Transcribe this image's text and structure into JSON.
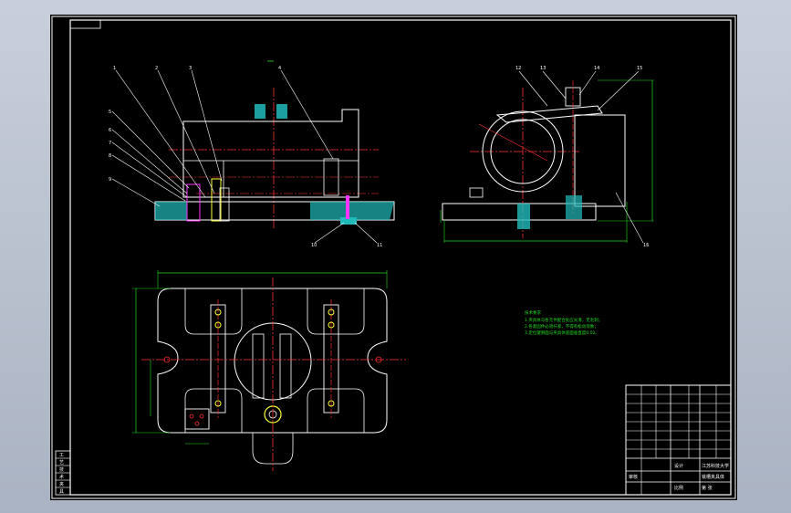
{
  "drawing": {
    "title_block": {
      "school": "江苏科技大学",
      "drawing_name": "铣槽夹具体",
      "designer": "设计",
      "checker": "审核",
      "scale": "比例",
      "sheet": "第 张"
    },
    "side_strip": [
      "工",
      "艺",
      "技",
      "术",
      "夹",
      "具"
    ],
    "notes": [
      "技术要求",
      "1.夹具体与各元件配合处应光滑，无毛刺；",
      "2.各紧固件必须拧紧，不得有松动现象；",
      "3.定位键侧面与夹具体底面垂直度0.02。"
    ],
    "balloons": [
      "1",
      "2",
      "3",
      "4",
      "5",
      "6",
      "7",
      "8",
      "9",
      "10",
      "11",
      "12",
      "13",
      "14",
      "15",
      "16"
    ]
  },
  "colors": {
    "sheet": "#000000",
    "outline": "#ffffff",
    "centerline": "#ff3030",
    "dimension": "#22dd22",
    "hatch": "#22bbbb",
    "magenta": "#ff33ff",
    "yellow": "#ffff33"
  }
}
